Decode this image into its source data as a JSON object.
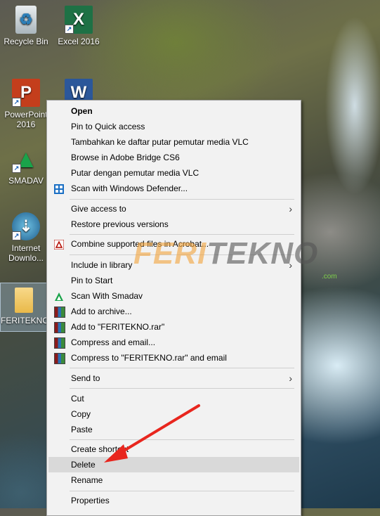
{
  "desktop": {
    "icons": [
      {
        "label": "Recycle Bin",
        "glyph": "♻",
        "color": "#cfd8dc"
      },
      {
        "label": "Excel 2016",
        "glyph": "X",
        "color": "#1e7145"
      },
      {
        "label": "PowerPoint 2016",
        "glyph": "P",
        "color": "#c43e1c"
      },
      {
        "label": "Word",
        "glyph": "W",
        "color": "#2b579a"
      },
      {
        "label": "SMADAV",
        "glyph": "▲",
        "color": "#1aa34a"
      },
      {
        "label": "Internet Downlo...",
        "glyph": "⇣",
        "color": "#2d8a3c"
      },
      {
        "label": "FERITEKNO",
        "glyph": "",
        "color": "#f3c969"
      }
    ]
  },
  "context_menu": {
    "items": [
      {
        "label": "Open"
      },
      {
        "label": "Pin to Quick access"
      },
      {
        "label": "Tambahkan ke daftar putar pemutar media VLC"
      },
      {
        "label": "Browse in Adobe Bridge CS6"
      },
      {
        "label": "Putar dengan pemutar media VLC"
      },
      {
        "label": "Scan with Windows Defender..."
      },
      {
        "label": "Give access to"
      },
      {
        "label": "Restore previous versions"
      },
      {
        "label": "Combine supported files in Acrobat..."
      },
      {
        "label": "Include in library"
      },
      {
        "label": "Pin to Start"
      },
      {
        "label": "Scan With Smadav"
      },
      {
        "label": "Add to archive..."
      },
      {
        "label": "Add to \"FERITEKNO.rar\""
      },
      {
        "label": "Compress and email..."
      },
      {
        "label": "Compress to \"FERITEKNO.rar\" and email"
      },
      {
        "label": "Send to"
      },
      {
        "label": "Cut"
      },
      {
        "label": "Copy"
      },
      {
        "label": "Paste"
      },
      {
        "label": "Create shortcut"
      },
      {
        "label": "Delete"
      },
      {
        "label": "Rename"
      },
      {
        "label": "Properties"
      }
    ],
    "submenu_arrow": "›",
    "highlighted": "Delete"
  },
  "watermark": {
    "part1": "FERI",
    "part2": "TEKNO",
    "sub": ".com"
  },
  "annotation": {
    "color": "#e8261e"
  }
}
